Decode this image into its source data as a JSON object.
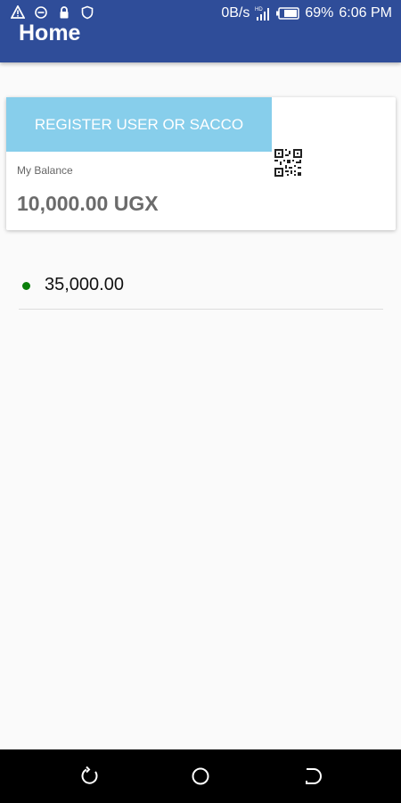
{
  "status_bar": {
    "network_speed": "0B/s",
    "signal_label": "HD",
    "battery": "69%",
    "time": "6:06 PM"
  },
  "app_bar": {
    "title": "Home"
  },
  "balance_card": {
    "register_button_label": "REGISTER USER OR SACCO",
    "balance_label": "My Balance",
    "balance_value": "10,000.00 UGX"
  },
  "transactions": [
    {
      "amount": "35,000.00",
      "status_color": "#0a7f0a"
    }
  ],
  "colors": {
    "app_bar": "#2f4d99",
    "register_button": "#87ceeb",
    "background": "#fafafa",
    "nav_bar": "#000000"
  },
  "icons": [
    "warning-icon",
    "do-not-disturb-icon",
    "lock-icon",
    "shield-icon",
    "signal-icon",
    "battery-icon",
    "qr-code-icon",
    "recent-apps-icon",
    "home-icon",
    "back-icon"
  ]
}
